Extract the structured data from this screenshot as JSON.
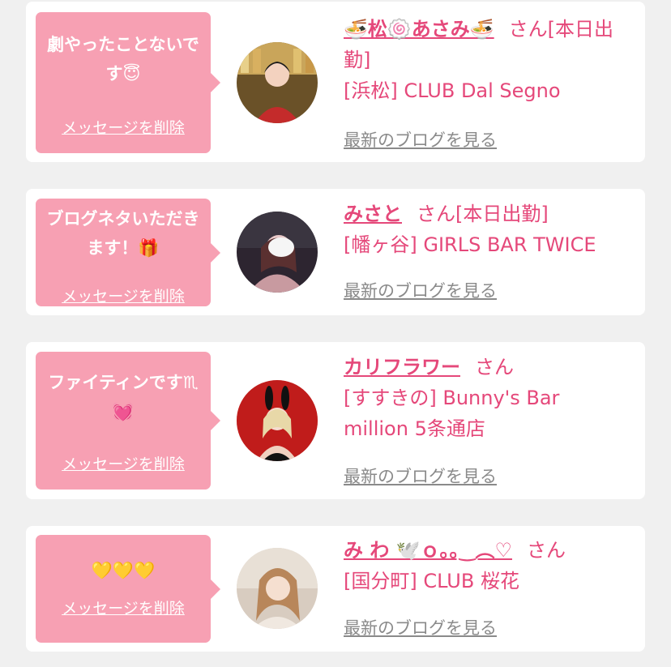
{
  "theme": {
    "accent": "#e5487a",
    "bubble": "#f7a0b3",
    "background": "#f0f0f0",
    "card": "#ffffff"
  },
  "items": [
    {
      "message": "劇やったことないです😇",
      "delete_label": "メッセージを削除",
      "avatar_icon": "avatar-woman-red-kimono",
      "name": "🍜松🍥あさみ🍜",
      "suffix": "さん[本日出勤]",
      "shop": "[浜松] CLUB Dal Segno",
      "blog_label": "最新のブログを見る"
    },
    {
      "message": "ブログネタいただきます！🎁",
      "delete_label": "メッセージを削除",
      "avatar_icon": "avatar-woman-blurred",
      "name": "みさと",
      "suffix": "さん[本日出勤]",
      "shop": "[幡ヶ谷] GIRLS BAR TWICE",
      "blog_label": "最新のブログを見る"
    },
    {
      "message": "ファイティンです♏💓",
      "delete_label": "メッセージを削除",
      "avatar_icon": "avatar-woman-bunny-ears",
      "name": "カリフラワー",
      "suffix": "さん",
      "shop": "[すすきの] Bunny's Bar million 5条通店",
      "blog_label": "最新のブログを見る"
    },
    {
      "message": "💛💛💛",
      "delete_label": "メッセージを削除",
      "avatar_icon": "avatar-woman-blonde",
      "name": "み わ 🕊️ｏ｡｡‿︵♡",
      "suffix": "さん",
      "shop": "[国分町] CLUB 桜花",
      "blog_label": "最新のブログを見る"
    }
  ]
}
